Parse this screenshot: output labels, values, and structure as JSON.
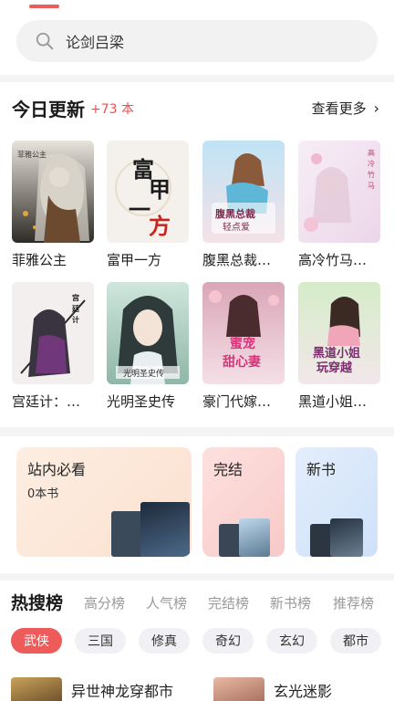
{
  "search": {
    "text": "论剑吕梁",
    "icon": "search-icon"
  },
  "today": {
    "title": "今日更新",
    "count": "+73 本",
    "more_label": "查看更多",
    "books": [
      {
        "title": "菲雅公主"
      },
      {
        "title": "富甲一方"
      },
      {
        "title": "腹黑总裁…"
      },
      {
        "title": "高冷竹马…"
      },
      {
        "title": "宫廷计：…"
      },
      {
        "title": "光明圣史传"
      },
      {
        "title": "豪门代嫁…"
      },
      {
        "title": "黑道小姐…"
      }
    ],
    "cover_texts": [
      "菲雅公主",
      "富甲一方",
      "腹黑总裁·轻点爱",
      "高冷竹马一撩到底",
      "宫廷计：军火女凰",
      "光明圣史传",
      "宠妻甜心妻",
      "黑道小姐玩穿越"
    ]
  },
  "cards": {
    "must_read": {
      "title": "站内必看",
      "sub": "0本书"
    },
    "finished": {
      "title": "完结"
    },
    "new_books": {
      "title": "新书"
    }
  },
  "hot": {
    "tabs": [
      "热搜榜",
      "高分榜",
      "人气榜",
      "完结榜",
      "新书榜",
      "推荐榜"
    ],
    "chips": [
      "武侠",
      "三国",
      "修真",
      "奇幻",
      "玄幻",
      "都市"
    ],
    "items": [
      {
        "title": "异世神龙穿都市"
      },
      {
        "title": "玄光迷影"
      }
    ]
  },
  "colors": {
    "accent": "#ee5b5b",
    "count": "#ee4f4f"
  }
}
